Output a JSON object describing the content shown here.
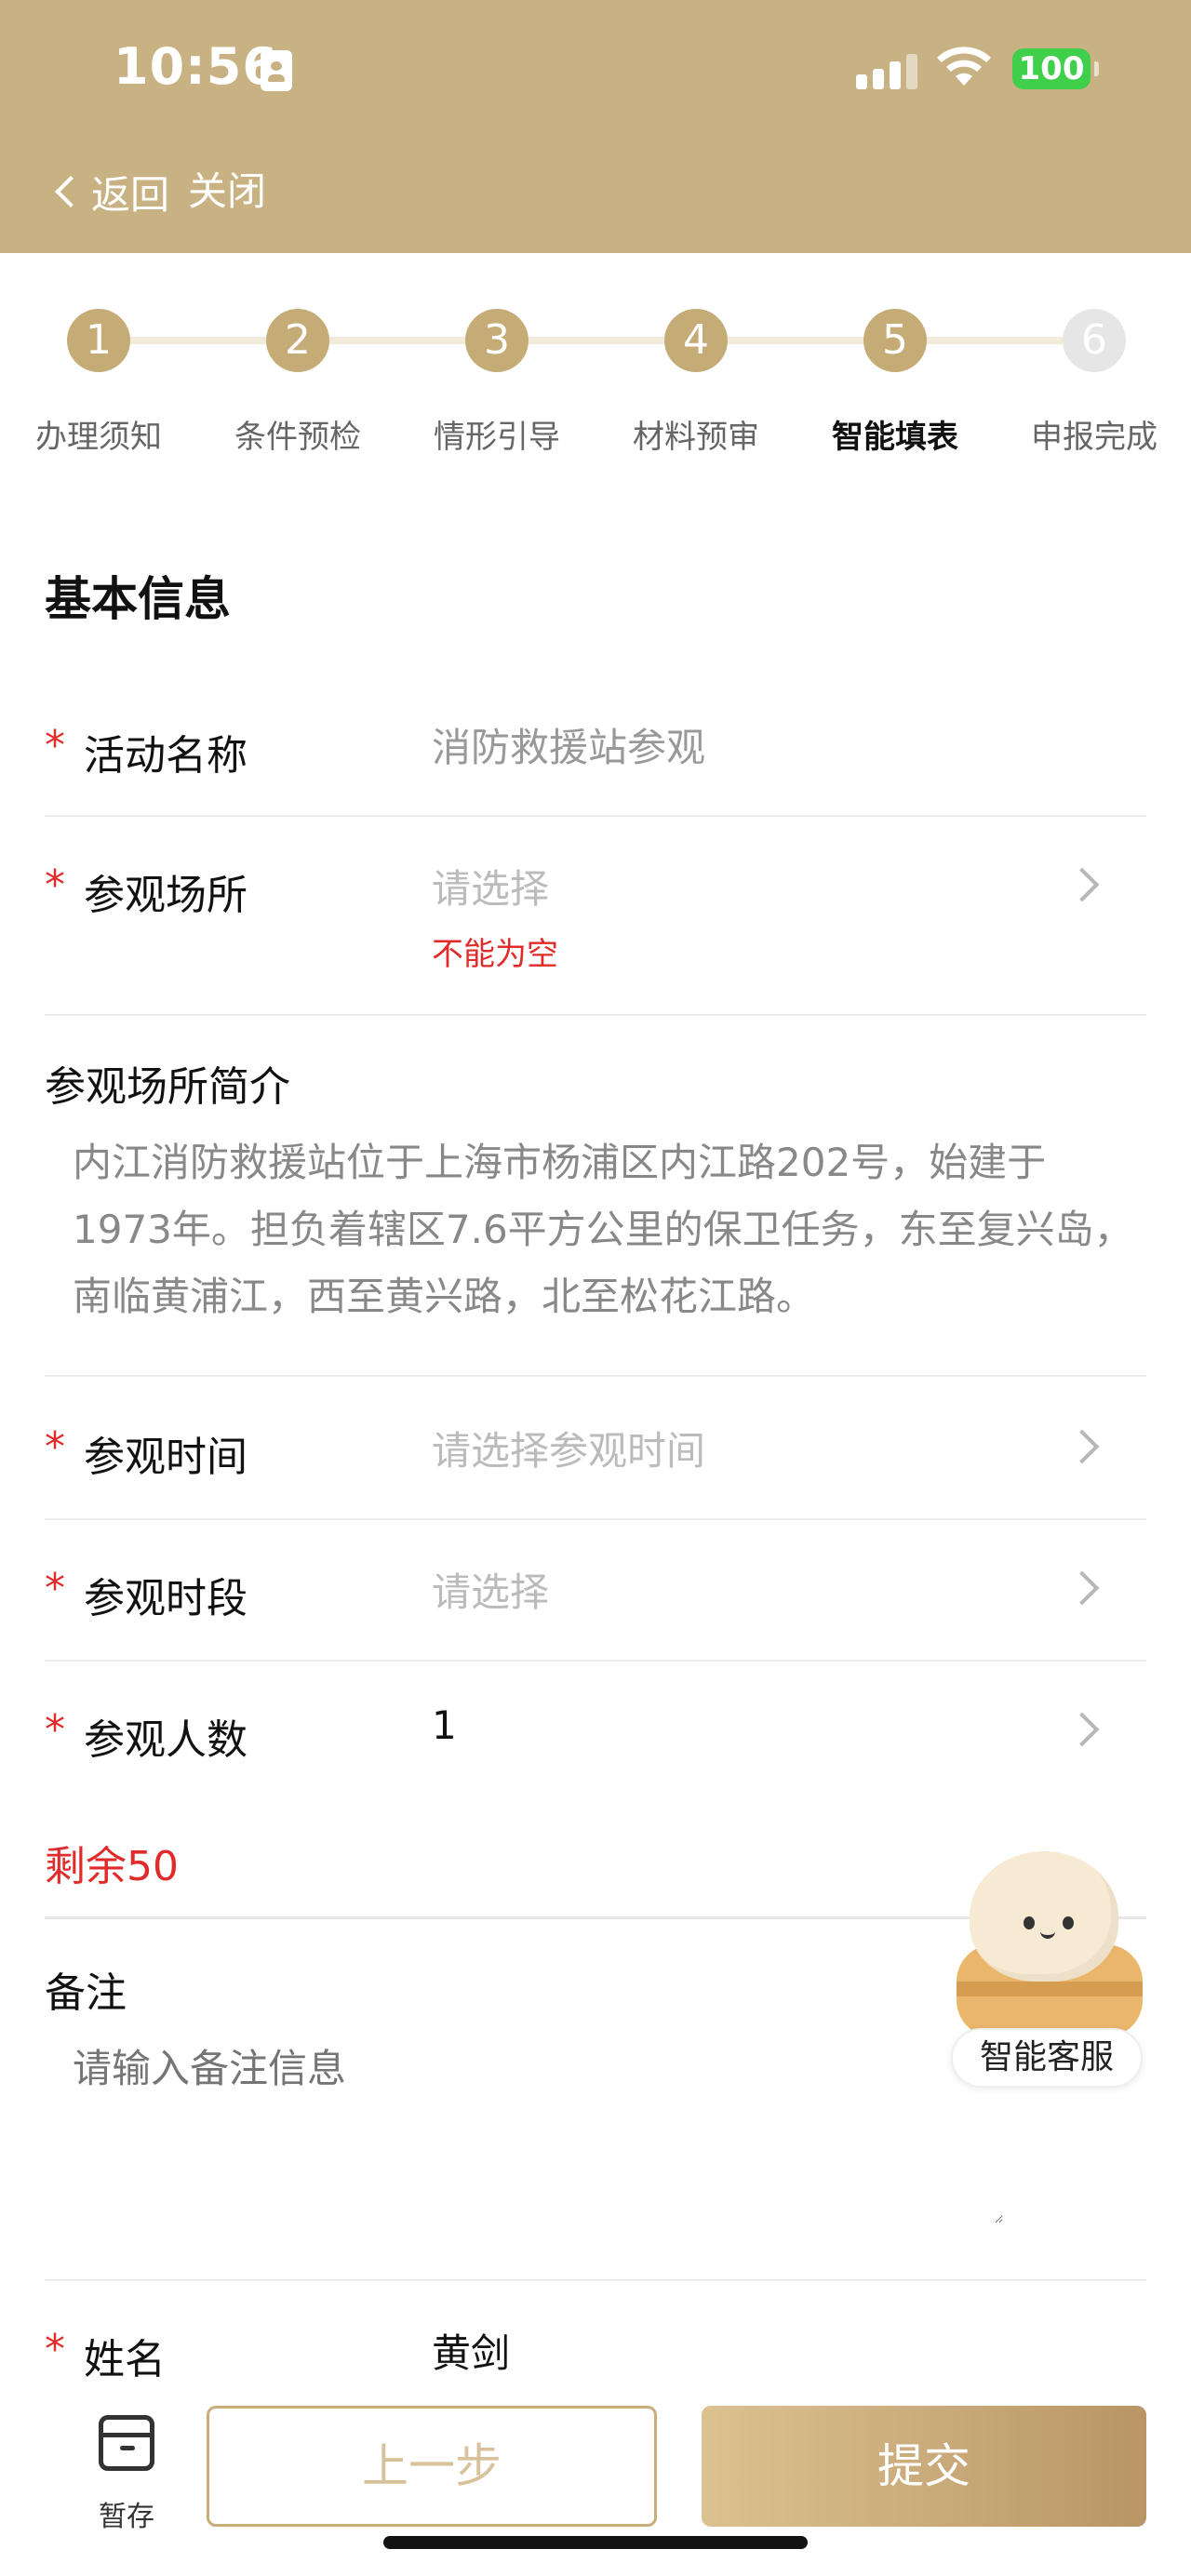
{
  "status_bar": {
    "time": "10:56",
    "battery": "100"
  },
  "nav": {
    "back": "返回",
    "close": "关闭"
  },
  "steps": [
    {
      "num": "1",
      "label": "办理须知"
    },
    {
      "num": "2",
      "label": "条件预检"
    },
    {
      "num": "3",
      "label": "情形引导"
    },
    {
      "num": "4",
      "label": "材料预审"
    },
    {
      "num": "5",
      "label": "智能填表"
    },
    {
      "num": "6",
      "label": "申报完成"
    }
  ],
  "form": {
    "section_title": "基本信息",
    "required_mark": "*",
    "activity_name": {
      "label": "活动名称",
      "value": "消防救援站参观"
    },
    "venue": {
      "label": "参观场所",
      "placeholder": "请选择",
      "error": "不能为空"
    },
    "venue_intro": {
      "label": "参观场所简介",
      "text": "内江消防救援站位于上海市杨浦区内江路202号，始建于1973年。担负着辖区7.6平方公里的保卫任务，东至复兴岛，南临黄浦江，西至黄兴路，北至松花江路。"
    },
    "visit_time": {
      "label": "参观时间",
      "placeholder": "请选择参观时间"
    },
    "visit_period": {
      "label": "参观时段",
      "placeholder": "请选择"
    },
    "visitor_count": {
      "label": "参观人数",
      "value": "1"
    },
    "remaining": "剩余50",
    "note": {
      "label": "备注",
      "placeholder": "请输入备注信息"
    },
    "name": {
      "label": "姓名",
      "value": "黄剑"
    }
  },
  "assistant": {
    "label": "智能客服"
  },
  "bottom": {
    "save": "暂存",
    "prev": "上一步",
    "submit": "提交"
  },
  "colors": {
    "header": "#c8b283",
    "step_active": "#c5ab76",
    "error": "#e12b2b"
  }
}
